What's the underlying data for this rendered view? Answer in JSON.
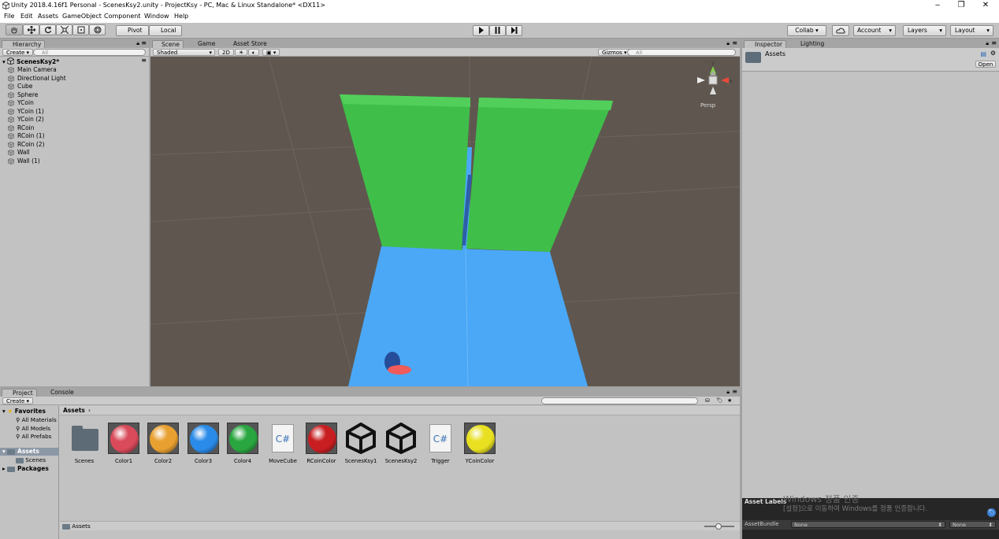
{
  "window": {
    "title": "Unity 2018.4.16f1 Personal - ScenesKsy2.unity - ProjectKsy - PC, Mac & Linux Standalone* <DX11>",
    "controls": [
      "‒",
      "❐",
      "✕"
    ]
  },
  "menu": [
    "File",
    "Edit",
    "Assets",
    "GameObject",
    "Component",
    "Window",
    "Help"
  ],
  "toolbar": {
    "pivot_label": "Pivot",
    "local_label": "Local",
    "collab_label": "Collab ▾",
    "account_label": "Account",
    "layers_label": "Layers",
    "layout_label": "Layout"
  },
  "hierarchy": {
    "tab_label": "Hierarchy",
    "create_label": "Create",
    "search_placeholder": "All",
    "scene_name": "ScenesKsy2*",
    "items": [
      "Main Camera",
      "Directional Light",
      "Cube",
      "Sphere",
      "YCoin",
      "YCoin (1)",
      "YCoin (2)",
      "RCoin",
      "RCoin (1)",
      "RCoin (2)",
      "Wall",
      "Wall (1)"
    ]
  },
  "scene_view": {
    "tabs": [
      "Scene",
      "Game",
      "Asset Store"
    ],
    "shading_mode": "Shaded",
    "mode_2d": "2D",
    "gizmos_label": "Gizmos",
    "search_placeholder": "All",
    "persp_label": "Persp",
    "colors": {
      "background": "#5f574f",
      "floor": "#4aa8f7",
      "wall": "#3fbf4a",
      "coin": "#f05b5b"
    }
  },
  "inspector": {
    "tabs": [
      "Inspector",
      "Lighting"
    ],
    "object_name": "Assets",
    "open_label": "Open",
    "asset_labels_title": "Asset Labels",
    "assetbundle_label": "AssetBundle",
    "assetbundle_value": "None",
    "assetbundle_variant": "None",
    "watermark_title": "Windows 정품 인증",
    "watermark_text": "[설정]으로 이동하여 Windows를 정품 인증합니다."
  },
  "project": {
    "tabs": [
      "Project",
      "Console"
    ],
    "create_label": "Create",
    "favorites_label": "Favorites",
    "favorites": [
      "All Materials",
      "All Models",
      "All Prefabs"
    ],
    "assets_label": "Assets",
    "assets_children": [
      "Scenes"
    ],
    "packages_label": "Packages",
    "breadcrumb": "Assets",
    "bottom_path": "Assets",
    "items": [
      {
        "name": "Scenes",
        "kind": "folder"
      },
      {
        "name": "Color1",
        "kind": "material",
        "color": "#d94a5a"
      },
      {
        "name": "Color2",
        "kind": "material",
        "color": "#e8a030"
      },
      {
        "name": "Color3",
        "kind": "material",
        "color": "#2a8be8"
      },
      {
        "name": "Color4",
        "kind": "material",
        "color": "#2aa640"
      },
      {
        "name": "MoveCube",
        "kind": "script"
      },
      {
        "name": "RCoinColor",
        "kind": "material",
        "color": "#c81e22"
      },
      {
        "name": "ScenesKsy1",
        "kind": "scene"
      },
      {
        "name": "ScenesKsy2",
        "kind": "scene"
      },
      {
        "name": "Trigger",
        "kind": "script"
      },
      {
        "name": "YCoinColor",
        "kind": "material",
        "color": "#e8e020"
      }
    ]
  }
}
